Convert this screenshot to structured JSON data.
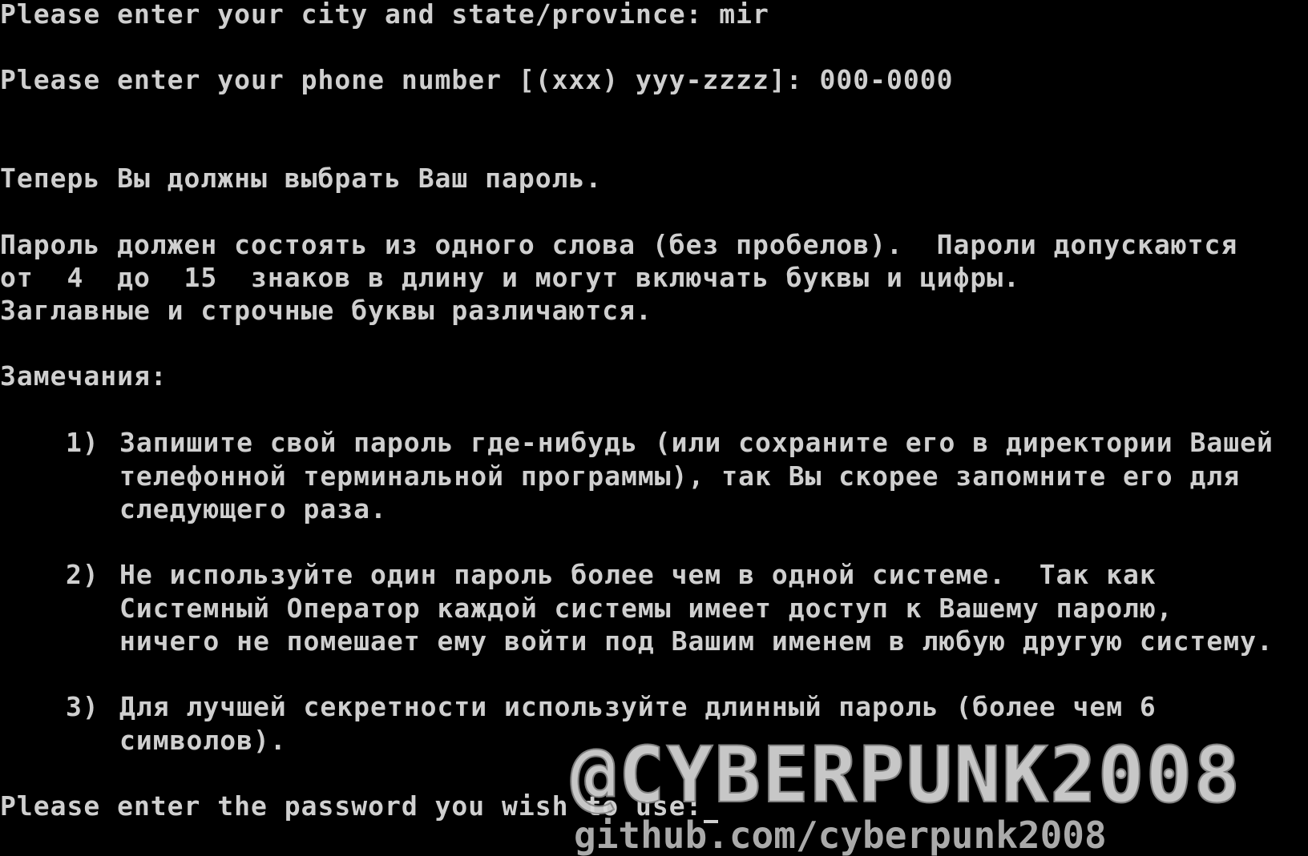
{
  "terminal": {
    "city_prompt": "Please enter your city and state/province: mir",
    "phone_prompt": "Please enter your phone number [(xxx) yyy-zzzz]: 000-0000",
    "choose_password": "Теперь Вы должны выбрать Ваш пароль.",
    "rules_line1": "Пароль должен состоять из одного слова (без пробелов).  Пароли допускаются",
    "rules_line2": "от  4  до  15  знаков в длину и могут включать буквы и цифры.",
    "rules_line3": "Заглавные и строчные буквы различаются.",
    "notes_heading": "Замечания:",
    "notes": [
      {
        "number": "1)",
        "lines": [
          "Запишите свой пароль где-нибудь (или сохраните его в директории Вашей",
          "телефонной терминальной программы), так Вы скорее запомните его для",
          "следующего раза."
        ]
      },
      {
        "number": "2)",
        "lines": [
          "Не используйте один пароль более чем в одной системе.  Так как",
          "Системный Оператор каждой системы имеет доступ к Вашему паролю,",
          "ничего не помешает ему войти под Вашим именем в любую другую систему."
        ]
      },
      {
        "number": "3)",
        "lines": [
          "Для лучшей секретности используйте длинный пароль (более чем 6",
          "символов)."
        ]
      }
    ],
    "password_prompt": "Please enter the password you wish to use:"
  },
  "watermark": {
    "handle": "@CYBERPUNK2008",
    "url": "github.com/cyberpunk2008"
  },
  "colors": {
    "background": "#000000",
    "text": "#cfcfcf"
  }
}
